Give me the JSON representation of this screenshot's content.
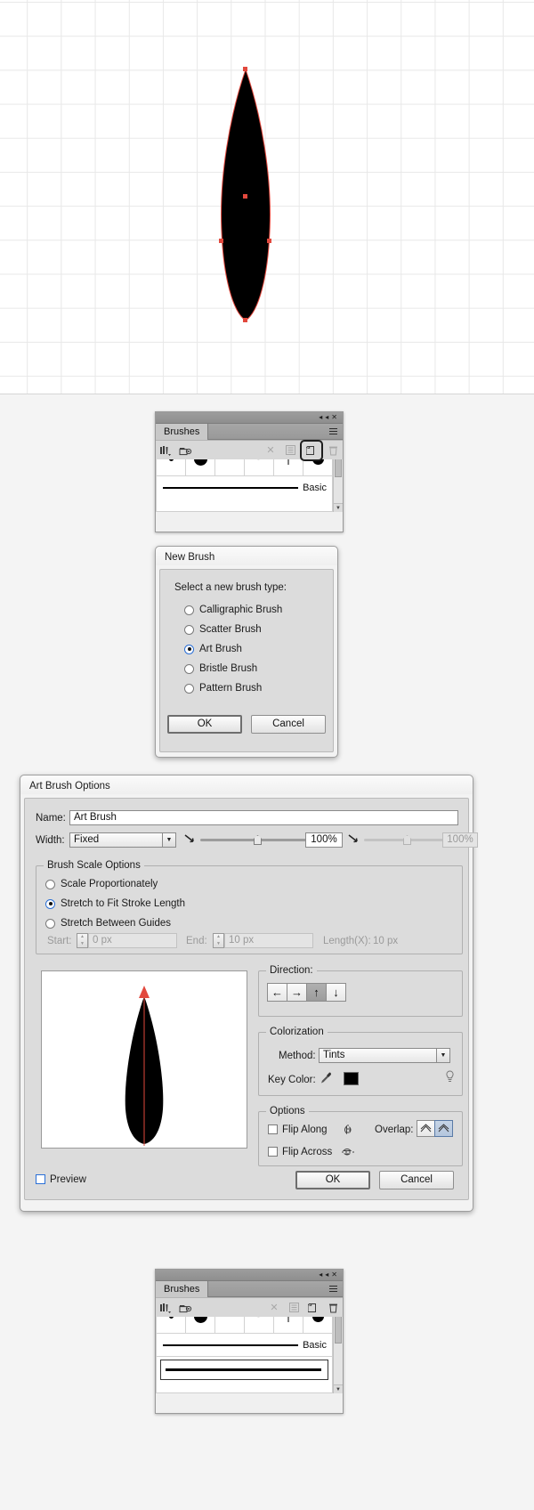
{
  "canvas": {
    "name": "illustrator-artboard",
    "shape": "black-leaf-teardrop-path",
    "grid": true
  },
  "brushes_panel_top": {
    "tab_label": "Brushes",
    "collapse_icon": "◂◂",
    "close_icon": "✕",
    "menu_icon": "panel-menu-icon",
    "swatches": [
      "small-dot",
      "large-dot",
      "tapered-stroke-left",
      "tapered-stroke-right",
      "thin-line",
      "large-dot"
    ],
    "rows": [
      {
        "label": "Basic",
        "type": "line"
      }
    ],
    "footer_icons": [
      "brush-libraries-icon",
      "libraries-panel-icon",
      "remove-brush-stroke-icon",
      "options-of-selected-object-icon",
      "new-brush-icon",
      "delete-brush-icon"
    ],
    "highlighted_footer_icon": "new-brush-icon"
  },
  "new_brush_dialog": {
    "title": "New Brush",
    "prompt": "Select a new brush type:",
    "options": [
      {
        "label": "Calligraphic Brush",
        "selected": false
      },
      {
        "label": "Scatter Brush",
        "selected": false
      },
      {
        "label": "Art Brush",
        "selected": true
      },
      {
        "label": "Bristle Brush",
        "selected": false
      },
      {
        "label": "Pattern Brush",
        "selected": false
      }
    ],
    "ok_label": "OK",
    "cancel_label": "Cancel"
  },
  "art_brush_options": {
    "title": "Art Brush Options",
    "name_label": "Name:",
    "name_value": "Art Brush",
    "width_label": "Width:",
    "width_value": "Fixed",
    "width_percent": "100%",
    "width_percent_secondary": "100%",
    "scale_group_title": "Brush Scale Options",
    "scale_options": [
      {
        "label": "Scale Proportionately",
        "selected": false
      },
      {
        "label": "Stretch to Fit Stroke Length",
        "selected": true
      },
      {
        "label": "Stretch Between Guides",
        "selected": false
      }
    ],
    "start_label": "Start:",
    "start_value": "0 px",
    "end_label": "End:",
    "end_value": "10 px",
    "length_label": "Length(X):",
    "length_value": "10 px",
    "direction_group_title": "Direction:",
    "direction_buttons": [
      {
        "icon": "arrow-left",
        "glyph": "←",
        "active": false
      },
      {
        "icon": "arrow-right",
        "glyph": "→",
        "active": false
      },
      {
        "icon": "arrow-up",
        "glyph": "↑",
        "active": true
      },
      {
        "icon": "arrow-down",
        "glyph": "↓",
        "active": false
      }
    ],
    "colorization_group_title": "Colorization",
    "method_label": "Method:",
    "method_value": "Tints",
    "key_color_label": "Key Color:",
    "key_color_hex": "#000000",
    "eyedropper_icon": "eyedropper-icon",
    "tip_icon": "tip-bulb-icon",
    "options_group_title": "Options",
    "flip_along_label": "Flip Along",
    "flip_along_checked": false,
    "flip_across_label": "Flip Across",
    "flip_across_checked": false,
    "overlap_label": "Overlap:",
    "overlap_buttons": [
      {
        "icon": "overlap-allow-icon",
        "active": false
      },
      {
        "icon": "overlap-prevent-icon",
        "active": true
      }
    ],
    "preview_label": "Preview",
    "preview_checked": false,
    "ok_label": "OK",
    "cancel_label": "Cancel"
  },
  "brushes_panel_bottom": {
    "tab_label": "Brushes",
    "collapse_icon": "◂◂",
    "close_icon": "✕",
    "swatches": [
      "small-dot",
      "large-dot",
      "tapered-stroke-left",
      "tapered-stroke-right",
      "thin-line",
      "large-dot"
    ],
    "rows": [
      {
        "label": "Basic",
        "type": "line"
      },
      {
        "label": "",
        "type": "new-art-brush-selected"
      }
    ],
    "footer_icons": [
      "brush-libraries-icon",
      "libraries-panel-icon",
      "remove-brush-stroke-icon",
      "options-of-selected-object-icon",
      "new-brush-icon",
      "delete-brush-icon"
    ]
  }
}
